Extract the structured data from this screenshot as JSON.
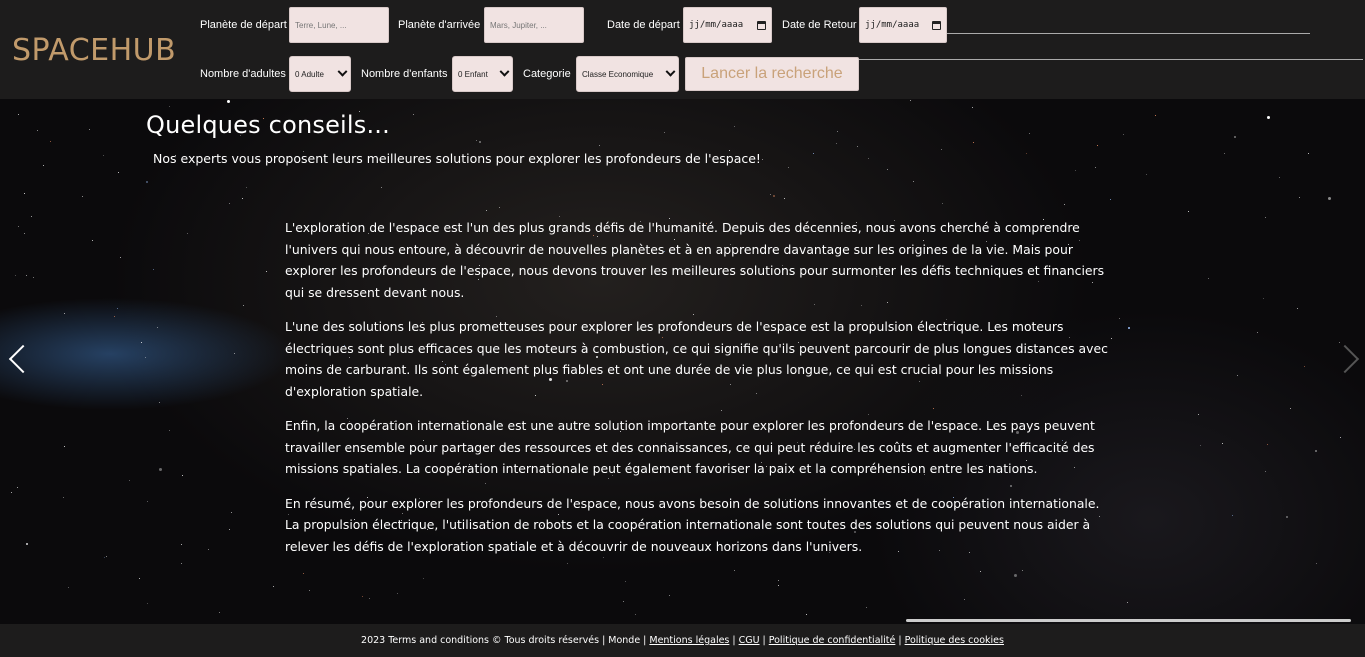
{
  "header": {
    "logo": "SPACEHUB",
    "departure_label": "Planète de départ",
    "departure_placeholder": "Terre, Lune, ...",
    "arrival_label": "Planète d'arrivée",
    "arrival_placeholder": "Mars, Jupiter, ...",
    "departure_date_label": "Date de départ",
    "departure_date_value": "jj/mm/aaaa",
    "return_date_label": "Date de Retour",
    "return_date_value": "jj/mm/aaaa",
    "adults_label": "Nombre d'adultes",
    "adults_value": "0 Adulte",
    "children_label": "Nombre d'enfants",
    "children_value": "0 Enfant",
    "category_label": "Categorie",
    "category_value": "Classe Economique",
    "search_button": "Lancer la recherche"
  },
  "hero": {
    "title": "Quelques conseils...",
    "subtitle": "Nos experts vous proposent leurs meilleures solutions pour explorer les profondeurs de l'espace!",
    "paragraphs": [
      "L'exploration de l'espace est l'un des plus grands défis de l'humanité. Depuis des décennies, nous avons cherché à comprendre l'univers qui nous entoure, à découvrir de nouvelles planètes et à en apprendre davantage sur les origines de la vie. Mais pour explorer les profondeurs de l'espace, nous devons trouver les meilleures solutions pour surmonter les défis techniques et financiers qui se dressent devant nous.",
      "L'une des solutions les plus prometteuses pour explorer les profondeurs de l'espace est la propulsion électrique. Les moteurs électriques sont plus efficaces que les moteurs à combustion, ce qui signifie qu'ils peuvent parcourir de plus longues distances avec moins de carburant. Ils sont également plus fiables et ont une durée de vie plus longue, ce qui est crucial pour les missions d'exploration spatiale.",
      "Enfin, la coopération internationale est une autre solution importante pour explorer les profondeurs de l'espace. Les pays peuvent travailler ensemble pour partager des ressources et des connaissances, ce qui peut réduire les coûts et augmenter l'efficacité des missions spatiales. La coopération internationale peut également favoriser la paix et la compréhension entre les nations.",
      "En résumé, pour explorer les profondeurs de l'espace, nous avons besoin de solutions innovantes et de coopération internationale. La propulsion électrique, l'utilisation de robots et la coopération internationale sont toutes des solutions qui peuvent nous aider à relever les défis de l'exploration spatiale et à découvrir de nouveaux horizons dans l'univers."
    ]
  },
  "footer": {
    "copyright": "2023 Terms and conditions © Tous droits réservés",
    "world": "Monde",
    "legal": "Mentions légales",
    "cgu": "CGU",
    "privacy": "Politique de confidentialité",
    "cookies": "Politique des cookies",
    "separator": "|"
  },
  "colors": {
    "header_bg": "#1d1c1c",
    "logo": "#c19a6b",
    "field_bg": "#f1e3e2",
    "button_text": "#c9a27a"
  },
  "icons": [
    "calendar-icon",
    "chevron-down-icon",
    "chevron-left-icon",
    "chevron-right-icon"
  ]
}
